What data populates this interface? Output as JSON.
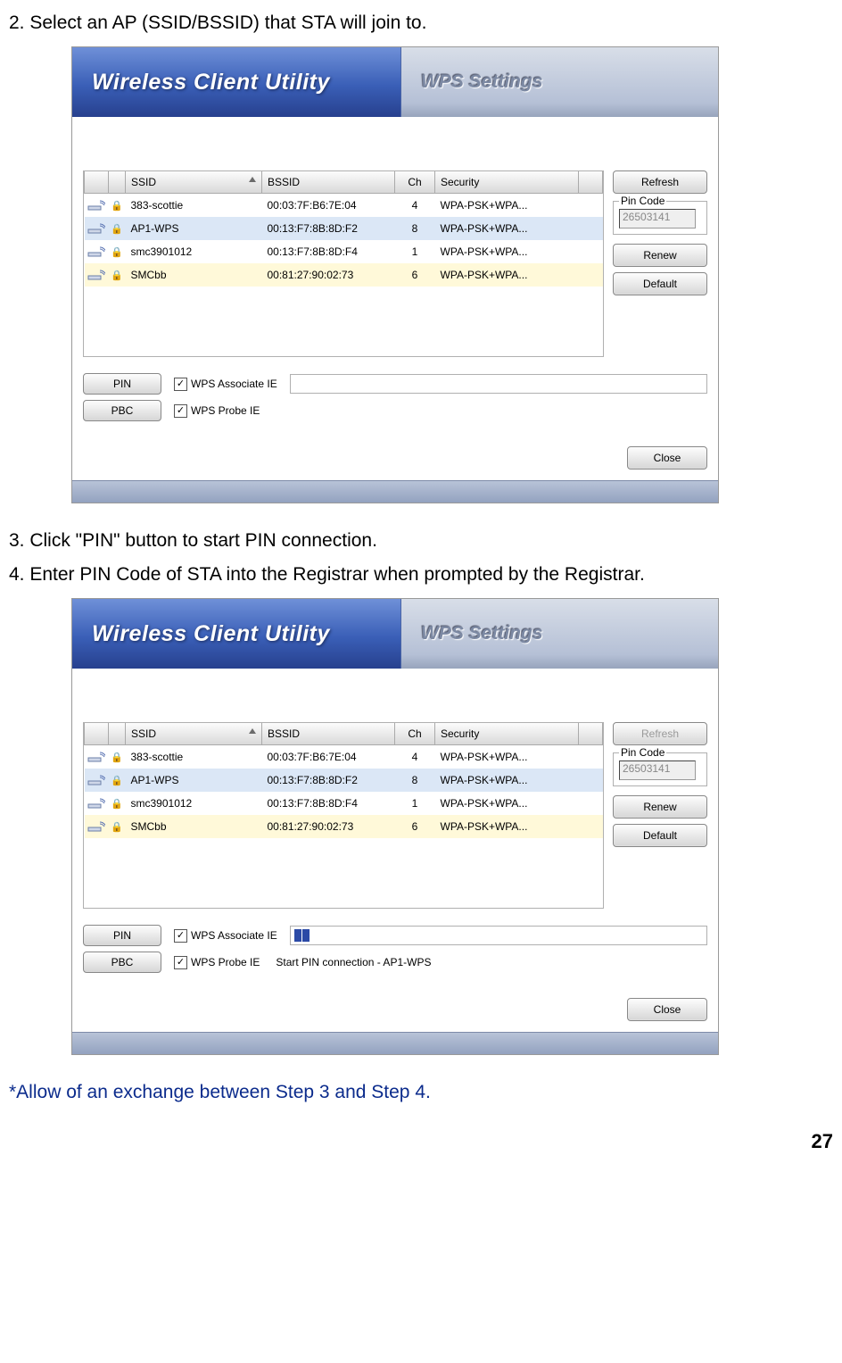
{
  "steps": {
    "s2": "2. Select an AP (SSID/BSSID) that STA will join to.",
    "s3": "3. Click \"PIN\" button to start PIN connection.",
    "s4": "4. Enter PIN Code of STA into the Registrar when prompted by the Registrar.",
    "note": "*Allow of an exchange between Step 3 and Step 4."
  },
  "page_number": "27",
  "app": {
    "title": "Wireless Client Utility",
    "tab": "WPS Settings",
    "columns": {
      "ssid": "SSID",
      "bssid": "BSSID",
      "ch": "Ch",
      "security": "Security"
    },
    "rows": [
      {
        "ssid": "383-scottie",
        "bssid": "00:03:7F:B6:7E:04",
        "ch": "4",
        "sec": "WPA-PSK+WPA..."
      },
      {
        "ssid": "AP1-WPS",
        "bssid": "00:13:F7:8B:8D:F2",
        "ch": "8",
        "sec": "WPA-PSK+WPA..."
      },
      {
        "ssid": "smc3901012",
        "bssid": "00:13:F7:8B:8D:F4",
        "ch": "1",
        "sec": "WPA-PSK+WPA..."
      },
      {
        "ssid": "SMCbb",
        "bssid": "00:81:27:90:02:73",
        "ch": "6",
        "sec": "WPA-PSK+WPA..."
      }
    ],
    "buttons": {
      "refresh": "Refresh",
      "renew": "Renew",
      "default": "Default",
      "pin": "PIN",
      "pbc": "PBC",
      "close": "Close"
    },
    "pin": {
      "legend": "Pin Code",
      "value": "26503141"
    },
    "checks": {
      "assoc": "WPS Associate IE",
      "probe": "WPS Probe IE"
    },
    "status2": "Start PIN connection - AP1-WPS"
  }
}
